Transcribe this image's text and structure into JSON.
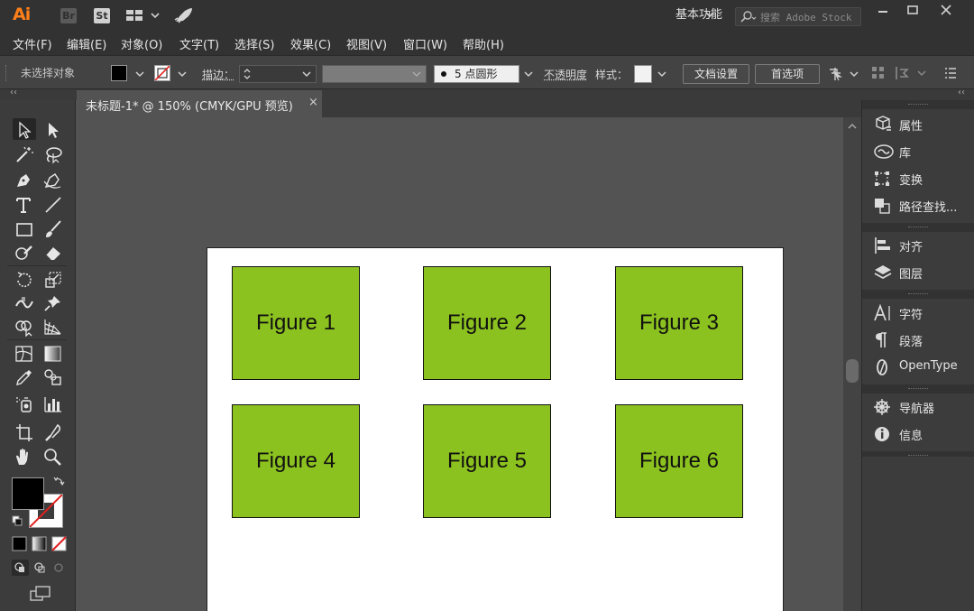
{
  "app": {
    "logo": "Ai",
    "bridge_badge": "Br",
    "stock_badge": "St",
    "workspace_label": "基本功能",
    "search_placeholder": "搜索 Adobe Stock"
  },
  "menu": [
    "文件(F)",
    "编辑(E)",
    "对象(O)",
    "文字(T)",
    "选择(S)",
    "效果(C)",
    "视图(V)",
    "窗口(W)",
    "帮助(H)"
  ],
  "control_bar": {
    "selection_status": "未选择对象",
    "stroke_label": "描边：",
    "brush_label": "5 点圆形",
    "opacity_label": "不透明度",
    "style_label": "样式：",
    "doc_setup_label": "文档设置",
    "preferences_label": "首选项"
  },
  "document": {
    "tab_title": "未标题-1* @ 150% (CMYK/GPU 预览)",
    "close_glyph": "×"
  },
  "artboard": {
    "fill_color": "#8cc21f",
    "figures": [
      "Figure 1",
      "Figure 2",
      "Figure 3",
      "Figure 4",
      "Figure 5",
      "Figure 6"
    ]
  },
  "panels": [
    {
      "label": "属性",
      "icon": "properties-icon"
    },
    {
      "label": "库",
      "icon": "libraries-icon"
    },
    {
      "label": "变换",
      "icon": "transform-icon"
    },
    {
      "label": "路径查找...",
      "icon": "pathfinder-icon"
    },
    {
      "label": "对齐",
      "icon": "align-icon"
    },
    {
      "label": "图层",
      "icon": "layers-icon"
    },
    {
      "label": "字符",
      "icon": "character-icon"
    },
    {
      "label": "段落",
      "icon": "paragraph-icon"
    },
    {
      "label": "OpenType",
      "icon": "opentype-icon"
    },
    {
      "label": "导航器",
      "icon": "navigator-icon"
    },
    {
      "label": "信息",
      "icon": "info-icon"
    }
  ],
  "colors": {
    "accent": "#ff7f18",
    "fill": "#000000",
    "stroke": "#ffffff",
    "artboard": "#ffffff",
    "figure_fill": "#8cc21f"
  }
}
